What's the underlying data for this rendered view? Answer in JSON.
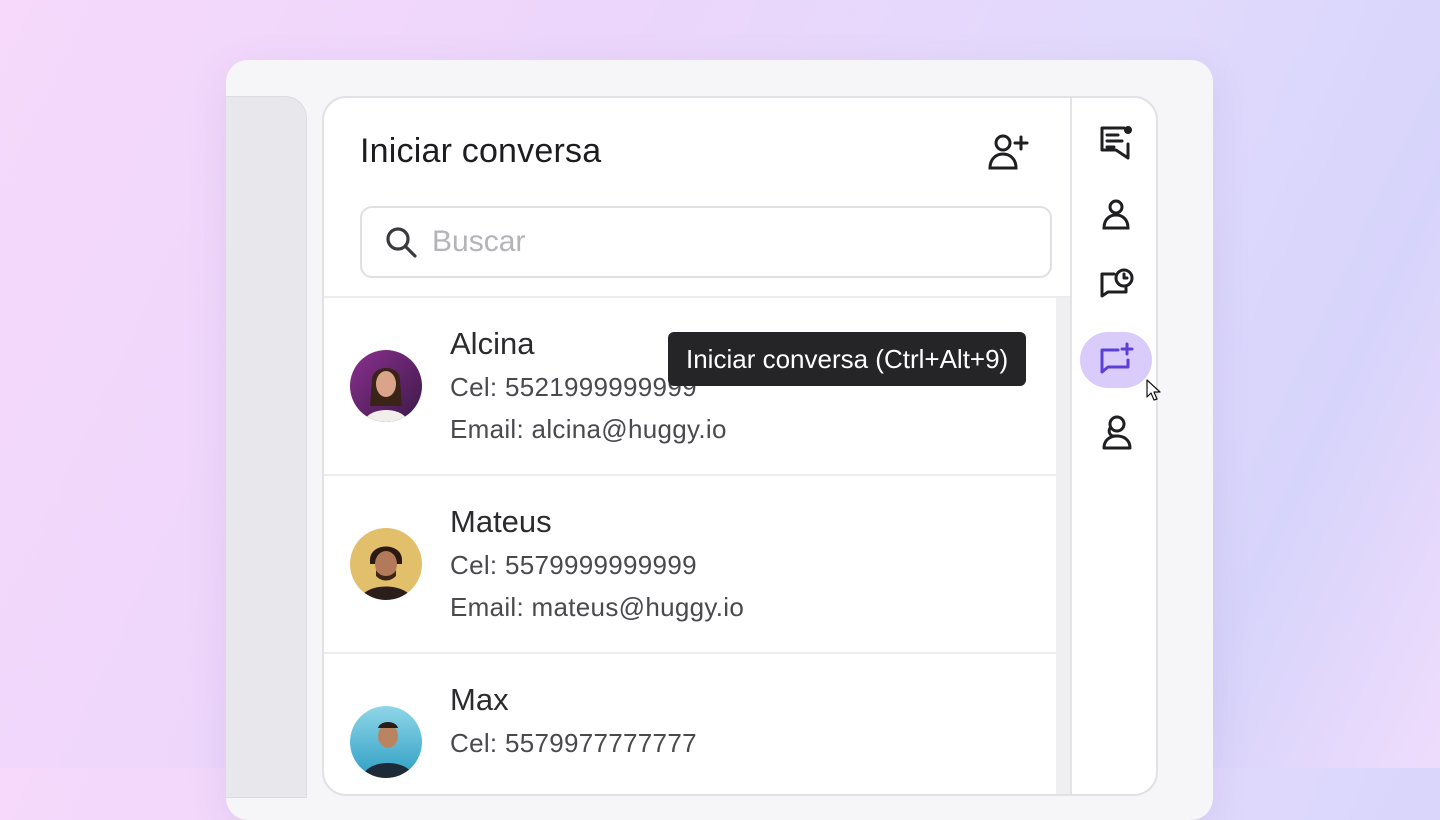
{
  "panel": {
    "title": "Iniciar conversa",
    "add_contact_icon": "user-plus-icon"
  },
  "search": {
    "placeholder": "Buscar",
    "value": "",
    "icon": "search-icon"
  },
  "contacts": [
    {
      "name": "Alcina",
      "phone": "Cel: 5521999999999",
      "email": "Email: alcina@huggy.io"
    },
    {
      "name": "Mateus",
      "phone": "Cel: 5579999999999",
      "email": "Email: mateus@huggy.io"
    },
    {
      "name": "Max",
      "phone": "Cel: 5579977777777",
      "email": ""
    }
  ],
  "rail": {
    "items": [
      {
        "icon": "notes-list-icon",
        "active": false
      },
      {
        "icon": "contact-user-icon",
        "active": false
      },
      {
        "icon": "chat-clock-icon",
        "active": false
      },
      {
        "icon": "new-chat-icon",
        "active": true
      },
      {
        "icon": "agent-support-icon",
        "active": false
      }
    ]
  },
  "tooltip": {
    "text": "Iniciar conversa (Ctrl+Alt+9)"
  },
  "colors": {
    "accent": "#5b3fd6",
    "accent_bg": "#d9ccfb",
    "tooltip_bg": "#252527",
    "text": "#1d1d20"
  }
}
